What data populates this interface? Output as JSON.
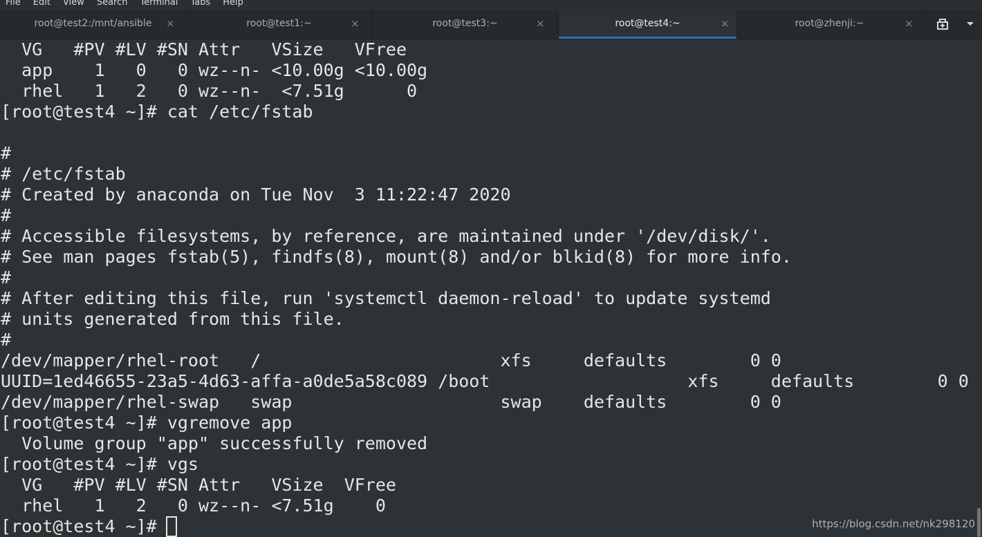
{
  "menu": [
    "File",
    "Edit",
    "View",
    "Search",
    "Terminal",
    "Tabs",
    "Help"
  ],
  "tabs": [
    {
      "title": "root@test2:/mnt/ansible",
      "active": false
    },
    {
      "title": "root@test1:~",
      "active": false
    },
    {
      "title": "root@test3:~",
      "active": false
    },
    {
      "title": "root@test4:~",
      "active": true
    },
    {
      "title": "root@zhenji:~",
      "active": false
    }
  ],
  "icons": {
    "tab_close": "×",
    "new_tab": "new-tab-icon",
    "dropdown": "chevron-down-icon"
  },
  "terminal": {
    "lines": [
      "  VG   #PV #LV #SN Attr   VSize   VFree  ",
      "  app    1   0   0 wz--n- <10.00g <10.00g",
      "  rhel   1   2   0 wz--n-  <7.51g      0 ",
      "[root@test4 ~]# cat /etc/fstab",
      "",
      "#",
      "# /etc/fstab",
      "# Created by anaconda on Tue Nov  3 11:22:47 2020",
      "#",
      "# Accessible filesystems, by reference, are maintained under '/dev/disk/'.",
      "# See man pages fstab(5), findfs(8), mount(8) and/or blkid(8) for more info.",
      "#",
      "# After editing this file, run 'systemctl daemon-reload' to update systemd",
      "# units generated from this file.",
      "#",
      "/dev/mapper/rhel-root   /                       xfs     defaults        0 0",
      "UUID=1ed46655-23a5-4d63-affa-a0de5a58c089 /boot                   xfs     defaults        0 0",
      "/dev/mapper/rhel-swap   swap                    swap    defaults        0 0",
      "[root@test4 ~]# vgremove app",
      "  Volume group \"app\" successfully removed",
      "[root@test4 ~]# vgs",
      "  VG   #PV #LV #SN Attr   VSize  VFree",
      "  rhel   1   2   0 wz--n- <7.51g    0 ",
      "[root@test4 ~]# "
    ]
  },
  "watermark": "https://blog.csdn.net/nk298120"
}
